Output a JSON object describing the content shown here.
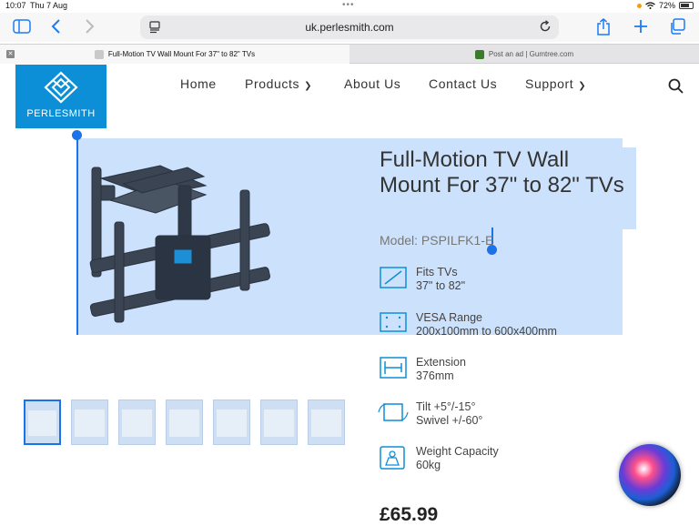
{
  "status": {
    "time": "10:07",
    "date": "Thu 7 Aug",
    "battery": "72%"
  },
  "browser": {
    "url": "uk.perlesmith.com",
    "tabs": [
      {
        "title": "Full-Motion TV Wall Mount For 37\" to 82\" TVs",
        "active": true
      },
      {
        "title": "Post an ad | Gumtree.com",
        "active": false
      }
    ]
  },
  "site": {
    "logo_text": "PERLESMITH",
    "nav": [
      {
        "label": "Home"
      },
      {
        "label": "Products"
      },
      {
        "label": "About Us"
      },
      {
        "label": "Contact Us"
      },
      {
        "label": "Support"
      }
    ]
  },
  "product": {
    "title": "Full-Motion TV Wall Mount For 37\" to 82\" TVs",
    "model": "Model: PSPILFK1-E",
    "thumbnail_count": 7,
    "specs": [
      {
        "label": "Fits TVs",
        "value": "37\" to 82\"",
        "icon": "tv-size-icon"
      },
      {
        "label": "VESA Range",
        "value": "200x100mm to 600x400mm",
        "icon": "vesa-icon"
      },
      {
        "label": "Extension",
        "value": "376mm",
        "icon": "extension-icon"
      },
      {
        "label": "Tilt +5°/-15°",
        "value": "Swivel +/-60°",
        "icon": "tilt-swivel-icon"
      },
      {
        "label": "Weight Capacity",
        "value": "60kg",
        "icon": "weight-icon"
      }
    ],
    "price": "£65.99"
  },
  "colors": {
    "accent": "#1a73e8",
    "brand": "#0d8fd8",
    "selection": "#cce1fb"
  }
}
